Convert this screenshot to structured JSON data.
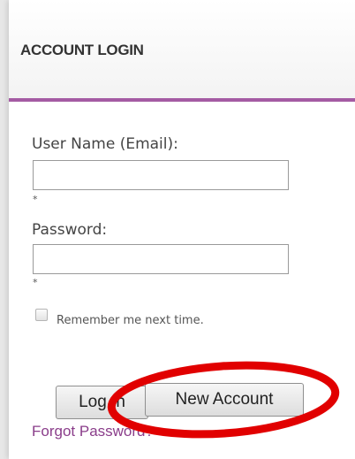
{
  "login_panel": {
    "title": "ACCOUNT LOGIN",
    "accent_color": "#a45ba3",
    "username_label": "User Name (Email):",
    "username_value": "",
    "password_label": "Password:",
    "password_value": "",
    "required_marker": "*",
    "remember_label": "Remember me next time.",
    "remember_checked": false,
    "login_button_label": "Log In",
    "new_account_button_label": "New Account",
    "forgot_password_label": "Forgot Password?"
  },
  "annotation": {
    "highlight_color": "#e10000",
    "target": "new-account-button"
  }
}
